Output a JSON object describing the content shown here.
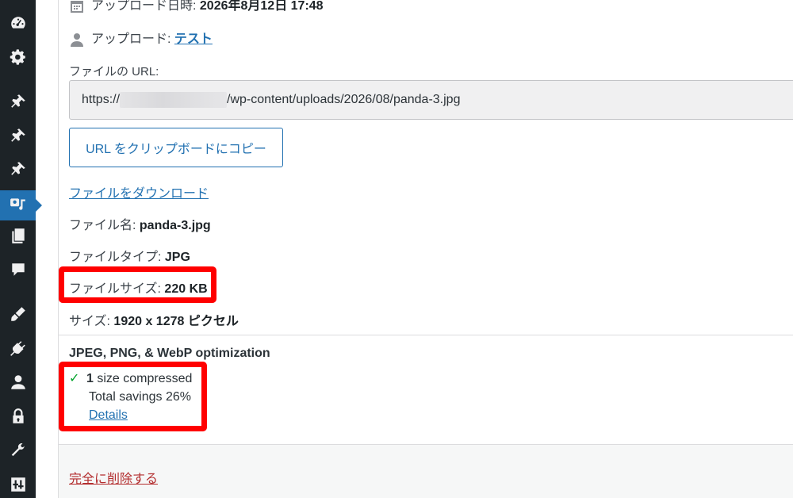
{
  "sidebar": {
    "items": [
      {
        "icon": "dashboard-icon",
        "active": false
      },
      {
        "icon": "gear-icon",
        "active": false
      },
      {
        "icon": "pin-icon",
        "active": false
      },
      {
        "icon": "pin-icon",
        "active": false
      },
      {
        "icon": "pin-icon",
        "active": false
      },
      {
        "icon": "media-icon",
        "active": true
      },
      {
        "icon": "pages-icon",
        "active": false
      },
      {
        "icon": "comments-icon",
        "active": false
      },
      {
        "icon": "appearance-icon",
        "active": false
      },
      {
        "icon": "plugins-icon",
        "active": false
      },
      {
        "icon": "users-icon",
        "active": false
      },
      {
        "icon": "lock-icon",
        "active": false
      },
      {
        "icon": "tools-icon",
        "active": false
      },
      {
        "icon": "settings-icon",
        "active": false
      }
    ]
  },
  "details": {
    "upload_date_label": "アップロード日時:",
    "upload_date_value": "2026年8月12日 17:48",
    "uploader_label": "アップロード:",
    "uploader_value": "テスト",
    "url_label": "ファイルの URL:",
    "url_prefix": "https://",
    "url_suffix": "/wp-content/uploads/2026/08/panda-3.jpg",
    "copy_button": "URL をクリップボードにコピー",
    "download_link": "ファイルをダウンロード",
    "filename_label": "ファイル名:",
    "filename_value": "panda-3.jpg",
    "filetype_label": "ファイルタイプ:",
    "filetype_value": "JPG",
    "filesize_label": "ファイルサイズ:",
    "filesize_value": "220 KB",
    "dimensions_label": "サイズ:",
    "dimensions_value": "1920 x 1278 ピクセル"
  },
  "optimization": {
    "title": "JPEG, PNG, & WebP optimization",
    "compressed_count": "1",
    "compressed_text": " size compressed",
    "savings": "Total savings 26%",
    "details_link": "Details"
  },
  "footer": {
    "delete_link": "完全に削除する"
  },
  "colors": {
    "sidebar_bg": "#1d2327",
    "accent": "#2271b1",
    "danger": "#b32d2e",
    "highlight": "#ff0000",
    "success": "#00a32a"
  }
}
